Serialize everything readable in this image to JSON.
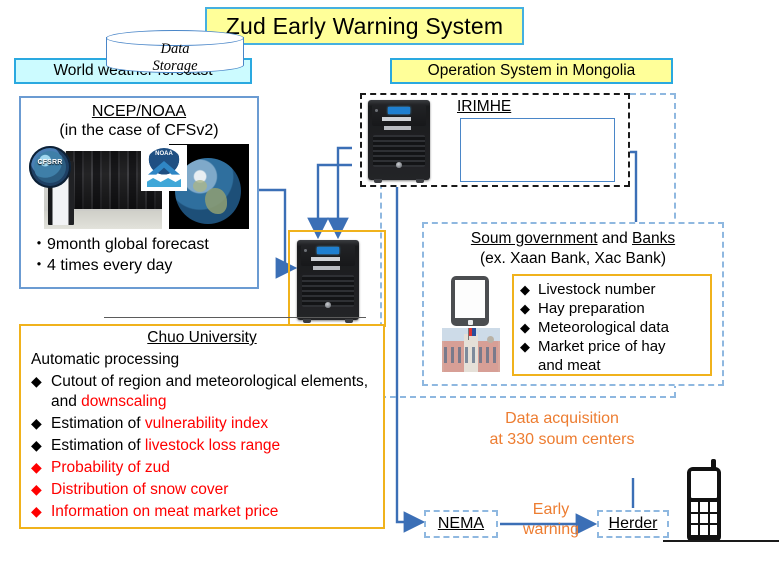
{
  "title": "Zud Early Warning System",
  "sections": {
    "weather_chip": "World weather forecast",
    "mongolia_chip": "Operation System in Mongolia"
  },
  "ncep": {
    "title": "NCEP/NOAA",
    "subtitle": "(in the case of CFSv2)",
    "bullets": [
      "・9month global forecast",
      "・4 times every day"
    ],
    "logo_left": "cfsrr-logo",
    "logo_right": "noaa-logo",
    "photo_left": "supercomputer-photo",
    "photo_right": "earth-photo"
  },
  "chuo": {
    "title": "Chuo University",
    "subtitle": "Automatic processing",
    "items": [
      {
        "marker_color": "#000000",
        "segments": [
          {
            "text": "Cutout of region and meteorological elements, and ",
            "color": "#000000"
          },
          {
            "text": "downscaling",
            "color": "#ff0000"
          }
        ]
      },
      {
        "marker_color": "#000000",
        "segments": [
          {
            "text": "Estimation of ",
            "color": "#000000"
          },
          {
            "text": "vulnerability index",
            "color": "#ff0000"
          }
        ]
      },
      {
        "marker_color": "#000000",
        "segments": [
          {
            "text": "Estimation of ",
            "color": "#000000"
          },
          {
            "text": "livestock loss range",
            "color": "#ff0000"
          }
        ]
      },
      {
        "marker_color": "#ff0000",
        "segments": [
          {
            "text": "Probability of zud",
            "color": "#ff0000"
          }
        ]
      },
      {
        "marker_color": "#ff0000",
        "segments": [
          {
            "text": "Distribution of snow cover",
            "color": "#ff0000"
          }
        ]
      },
      {
        "marker_color": "#ff0000",
        "segments": [
          {
            "text": "Information on meat market price",
            "color": "#ff0000"
          }
        ]
      }
    ]
  },
  "irimhe": {
    "label": "IRIMHE",
    "storage_line1": "Data",
    "storage_line2": "Storage",
    "server_icon": "server-tower-icon"
  },
  "soum": {
    "title_part1": "Soum government",
    "title_mid": " and ",
    "title_part2": "Banks",
    "subtitle": "(ex. Xaan Bank, Xac Bank)",
    "items": [
      "Livestock number",
      "Hay preparation",
      "Meteorological data",
      "Market price of hay"
    ],
    "items_last_continuation": "and meat",
    "tablet_icon": "tablet-icon",
    "building_photo": "soum-government-building-photo"
  },
  "annotations": {
    "data_acquisition_line1": "Data acquisition",
    "data_acquisition_line2": "at 330 soum centers",
    "early_warning_line1": "Early",
    "early_warning_line2": "warning"
  },
  "bottom": {
    "nema": "NEMA",
    "herder": "Herder",
    "phone_icon": "mobile-phone-icon"
  },
  "colors": {
    "title_bg": "#ffff99",
    "title_border": "#45b0e0",
    "weather_chip_bg": "#ccfbff",
    "mongolia_chip_bg": "#ffff99",
    "chip_border": "#2aa9e0",
    "orange_accent": "#ed7d31",
    "orange_frame": "#f0b21c",
    "red_text": "#ff0000",
    "arrow_blue": "#3b6fb6",
    "dashed_blue": "#8fb8e0"
  }
}
